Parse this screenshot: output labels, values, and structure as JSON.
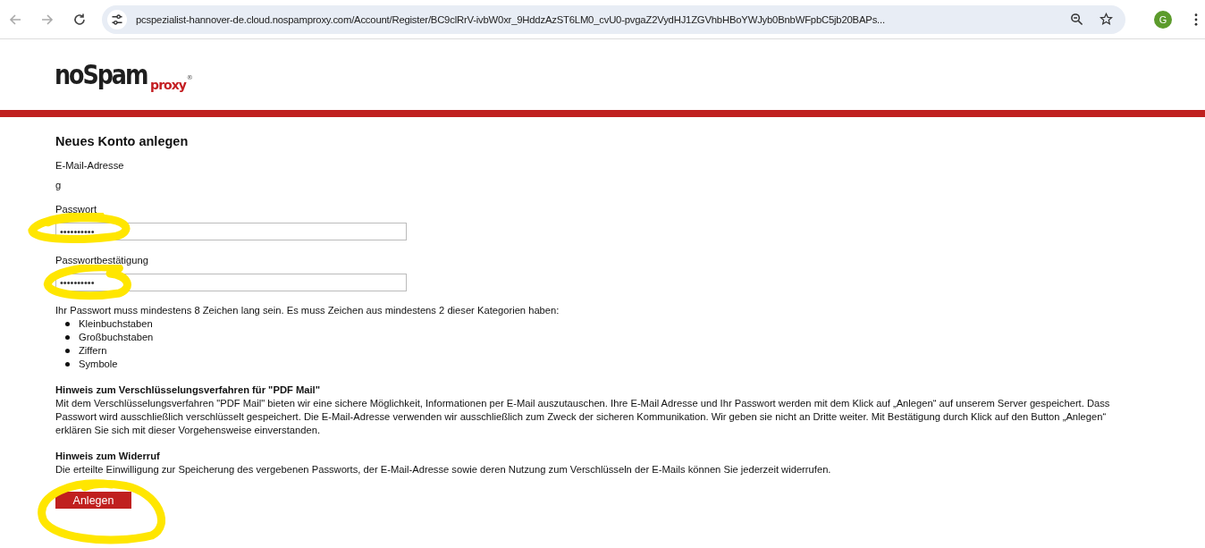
{
  "browser": {
    "url": "pcspezialist-hannover-de.cloud.nospamproxy.com/Account/Register/BC9clRrV-ivbW0xr_9HddzAzST6LM0_cvU0-pvgaZ2VydHJ1ZGVhbHBoYWJyb0BnbWFpbC5jb20BAPs...",
    "profile_initial": "G"
  },
  "logo": {
    "name": "noSpam",
    "sub": "proxy",
    "mark": "®"
  },
  "form": {
    "title": "Neues Konto anlegen",
    "email_label": "E-Mail-Adresse",
    "email_value": "g",
    "fields": [
      {
        "label": "Passwort",
        "value": "••••••••••",
        "highlighted": true
      },
      {
        "label": "Passwortbestätigung",
        "value": "••••••••••",
        "highlighted": true
      }
    ],
    "rules_intro": "Ihr Passwort muss mindestens 8 Zeichen lang sein. Es muss Zeichen aus mindestens 2 dieser Kategorien haben:",
    "rules": [
      "Kleinbuchstaben",
      "Großbuchstaben",
      "Ziffern",
      "Symbole"
    ],
    "notices": [
      {
        "heading": "Hinweis zum Verschlüsselungsverfahren für \"PDF Mail\"",
        "text": "Mit dem Verschlüsselungsverfahren \"PDF Mail\" bieten wir eine sichere Möglichkeit, Informationen per E-Mail auszutauschen. Ihre E-Mail Adresse und Ihr Passwort werden mit dem Klick auf „Anlegen“ auf unserem Server gespeichert. Dass Passwort wird ausschließlich verschlüsselt gespeichert. Die E-Mail-Adresse verwenden wir ausschließlich zum Zweck der sicheren Kommunikation. Wir geben sie nicht an Dritte weiter. Mit Bestätigung durch Klick auf den Button „Anlegen“ erklären Sie sich mit dieser Vorgehensweise einverstanden."
      },
      {
        "heading": "Hinweis zum Widerruf",
        "text": "Die erteilte Einwilligung zur Speicherung des vergebenen Passworts, der E-Mail-Adresse sowie deren Nutzung zum Verschlüsseln der E-Mails können Sie jederzeit widerrufen."
      }
    ],
    "submit": {
      "label": "Anlegen",
      "highlighted": true
    }
  }
}
